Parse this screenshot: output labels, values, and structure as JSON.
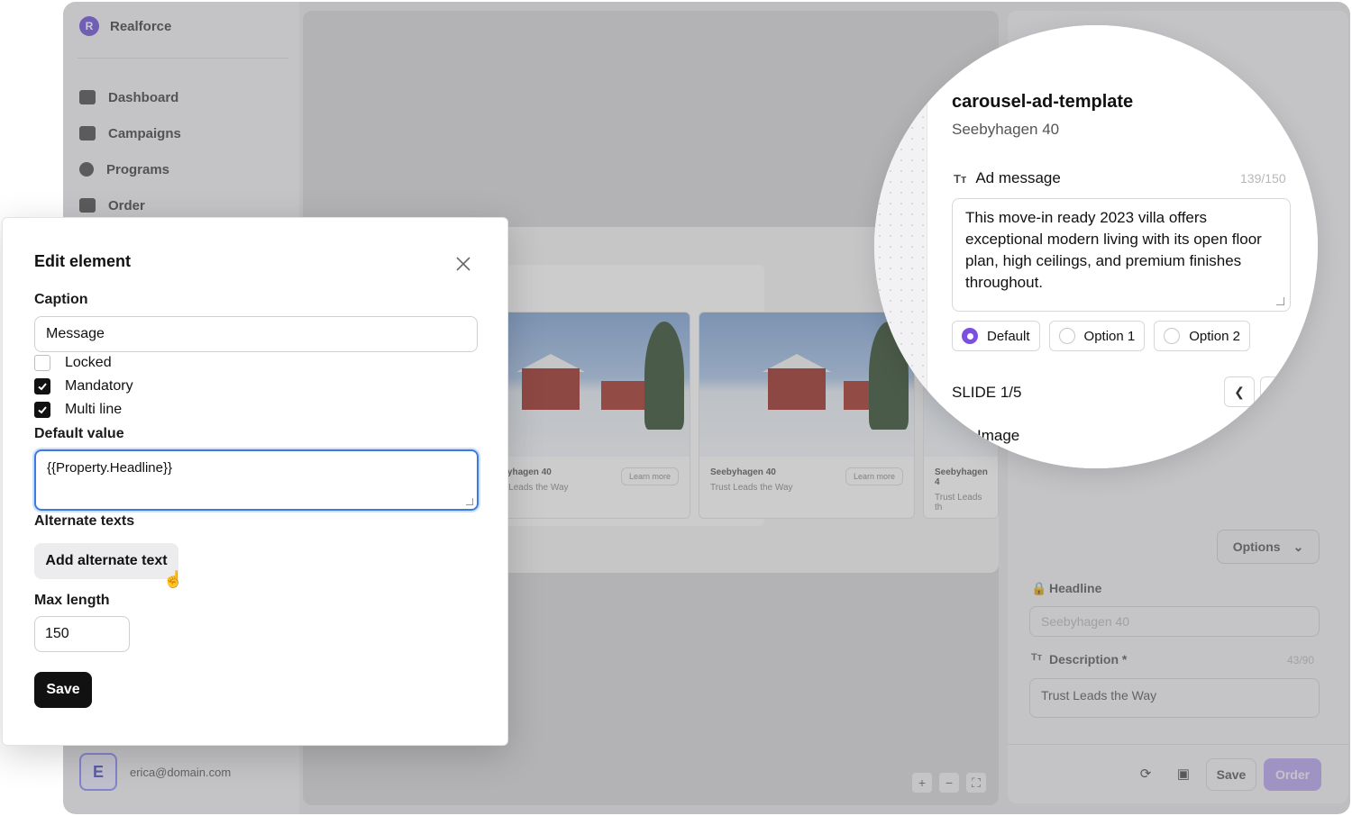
{
  "app": {
    "brand": "Realforce",
    "nav": [
      {
        "label": "Dashboard",
        "icon": "dashboard-icon"
      },
      {
        "label": "Campaigns",
        "icon": "campaigns-icon"
      },
      {
        "label": "Programs",
        "icon": "programs-icon"
      },
      {
        "label": "Order",
        "icon": "cart-icon"
      }
    ],
    "user": {
      "initial": "E",
      "email": "erica@domain.com"
    }
  },
  "canvas": {
    "slides": [
      {
        "caption": "Seebyhagen 40",
        "subtitle": "Trust Leads the Way",
        "cta": "Learn more"
      },
      {
        "caption": "Seebyhagen 40",
        "subtitle": "Trust Leads the Way",
        "cta": "Learn more"
      },
      {
        "caption": "Seebyhagen 4",
        "subtitle": "Trust Leads th"
      }
    ],
    "zoom": {
      "plus": "+",
      "minus": "−",
      "fit": "⛶"
    }
  },
  "right_panel": {
    "options_label": "Options",
    "headline_label": "Headline",
    "headline_value": "Seebyhagen 40",
    "description_label": "Description *",
    "description_value": "Trust Leads the Way",
    "description_count": "43/90",
    "save_label": "Save",
    "order_label": "Order"
  },
  "dialog": {
    "title": "Edit element",
    "caption_label": "Caption",
    "caption_value": "Message",
    "checks": [
      {
        "label": "Locked",
        "checked": false
      },
      {
        "label": "Mandatory",
        "checked": true
      },
      {
        "label": "Multi line",
        "checked": true
      }
    ],
    "default_label": "Default value",
    "default_value": "{{Property.Headline}}",
    "alt_label": "Alternate texts",
    "alt_button": "Add alternate text",
    "max_label": "Max length",
    "max_value": "150",
    "save": "Save"
  },
  "magnifier": {
    "template_name": "carousel-ad-template",
    "property": "Seebyhagen 40",
    "field_label": "Ad message",
    "field_icon": "Tт",
    "count": "139/150",
    "message": "This move-in ready 2023 villa offers exceptional modern living with its open floor plan, high ceilings, and premium finishes throughout.",
    "radios": [
      {
        "label": "Default",
        "selected": true
      },
      {
        "label": "Option 1",
        "selected": false
      },
      {
        "label": "Option 2",
        "selected": false
      }
    ],
    "slide_label": "SLIDE 1/5",
    "image_label": "Image"
  },
  "colors": {
    "accent": "#7b4fe0",
    "focus": "#3a7be0",
    "order": "#b7a3f0"
  }
}
